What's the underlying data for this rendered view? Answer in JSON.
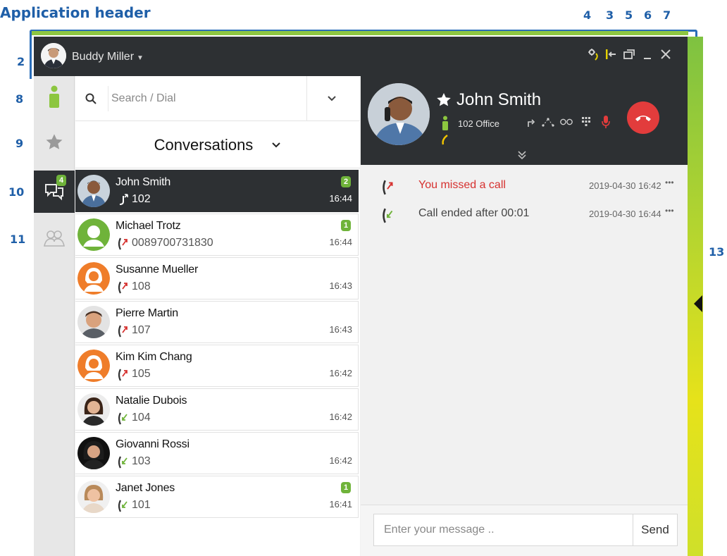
{
  "annotations": {
    "title": "Application header",
    "numbers": [
      "2",
      "3",
      "4",
      "5",
      "6",
      "7",
      "8",
      "9",
      "10",
      "11",
      "13"
    ]
  },
  "header": {
    "user_name": "Buddy Miller",
    "icons": [
      "settings-icon",
      "dock-icon",
      "popout-icon",
      "minimize-icon",
      "close-icon"
    ]
  },
  "leftbar": {
    "items": [
      {
        "name": "status",
        "icon": "person-icon"
      },
      {
        "name": "favorites",
        "icon": "star-icon"
      },
      {
        "name": "conversations",
        "icon": "chat-icon",
        "badge": "4",
        "active": true
      },
      {
        "name": "groups",
        "icon": "group-icon"
      }
    ]
  },
  "search": {
    "placeholder": "Search / Dial"
  },
  "list": {
    "title": "Conversations",
    "rows": [
      {
        "name": "John Smith",
        "number": "102",
        "time": "16:44",
        "badge": "2",
        "call": "active",
        "active": true
      },
      {
        "name": "Michael Trotz",
        "number": "0089700731830",
        "time": "16:44",
        "badge": "1",
        "call": "missed"
      },
      {
        "name": "Susanne Mueller",
        "number": "108",
        "time": "16:43",
        "badge": "",
        "call": "missed"
      },
      {
        "name": "Pierre Martin",
        "number": "107",
        "time": "16:43",
        "badge": "",
        "call": "missed"
      },
      {
        "name": "Kim Kim Chang",
        "number": "105",
        "time": "16:42",
        "badge": "",
        "call": "missed"
      },
      {
        "name": "Natalie Dubois",
        "number": "104",
        "time": "16:42",
        "badge": "",
        "call": "answered"
      },
      {
        "name": "Giovanni Rossi",
        "number": "103",
        "time": "16:42",
        "badge": "",
        "call": "answered"
      },
      {
        "name": "Janet Jones",
        "number": "101",
        "time": "16:41",
        "badge": "1",
        "call": "answered"
      }
    ]
  },
  "detail": {
    "name": "John Smith",
    "extension": "102 Office",
    "timeline": [
      {
        "text": "You missed a call",
        "time": "2019-04-30 16:42",
        "dots": "•••",
        "type": "missed"
      },
      {
        "text": "Call ended after 00:01",
        "time": "2019-04-30 16:44",
        "dots": "•••",
        "type": "answered"
      }
    ]
  },
  "composer": {
    "placeholder": "Enter your message ..",
    "send_label": "Send"
  },
  "colors": {
    "dark": "#2d3033",
    "green": "#6fb33a",
    "missed": "#d6312f",
    "hangup": "#e23c3c",
    "annotation": "#1f5fa8"
  }
}
